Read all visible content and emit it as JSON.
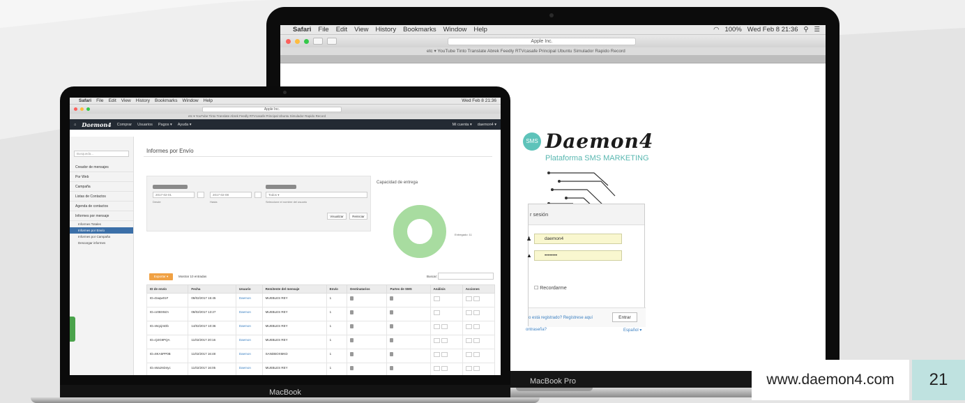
{
  "colors": {
    "accent_teal": "#5ec3ba",
    "export_orange": "#f0a144",
    "active_blue": "#3b6fa8",
    "nav_dark": "#232a33",
    "donut_green": "#a8dca0"
  },
  "menubar": {
    "app": "Safari",
    "items": [
      "File",
      "Edit",
      "View",
      "History",
      "Bookmarks",
      "Window",
      "Help"
    ],
    "battery": "100%",
    "datetime": "Wed Feb 8 21:36"
  },
  "front_menubar": {
    "datetime": "Wed Feb 8 21:36"
  },
  "browser": {
    "url": "Apple Inc.",
    "bookmarks": "etc ▾  YouTube  Tinto  Translate  Abrek  Feedly  RTVcasafe  Principal  Ubuntu  Simulador Rapido Record"
  },
  "login": {
    "sms_badge": "SMS",
    "brand": "Daemon4",
    "subtitle": "Plataforma SMS MARKETING",
    "panel_title": "r sesión",
    "username": "daemon4",
    "password": "••••••••",
    "remember": "Recordarme",
    "register": "o está registrado? Regístrese aquí",
    "enter_button": "Entrar",
    "forgot": "ontraseña?",
    "language": "Español ▾"
  },
  "app": {
    "brand": "Daemon4",
    "nav": [
      "Comprar",
      "Usuarios",
      "Pagos ▾",
      "Ayuda ▾"
    ],
    "nav_right": [
      "Mi cuenta ▾",
      "daemon4 ▾"
    ],
    "sidebar_search": "Busqueda...",
    "sidebar": [
      "Creador de mensajes",
      "Por Web",
      "Campaña",
      "Listas de Contactos",
      "Agenda de contactos",
      "Informes por mensaje"
    ],
    "sidebar_sub": [
      "Informes Totales",
      "Informes por Envío",
      "Informes por Campaña",
      "Descargar informes"
    ],
    "page_title": "Informes por Envío",
    "filter": {
      "date_from": "2017-02-01",
      "date_to": "2017-02-08",
      "cap_from": "Desde",
      "cap_to": "Hasta",
      "user": "Todos ▾",
      "user_caption": "Seleccione el nombre del usuario",
      "button_search": "Visualizar",
      "button_reset": "Reiniciar"
    },
    "capacity_title": "Capacidad de entrega",
    "legend": "Entregado: 11",
    "export_button": "Exportar ▾",
    "show": "Mostrar 10 entradas",
    "search_label": "Buscar:",
    "table": {
      "headers": [
        "ID de envío",
        "Fecha",
        "Usuario",
        "Remitente del mensaje",
        "Envío",
        "Destinatarios",
        "Partes de SMS",
        "Análisis",
        "Acciones"
      ],
      "rows": [
        {
          "id": "ID=Daqw01F",
          "date": "08/02/2017 15:45",
          "user": "Daemon",
          "sender": "MUEBLES REY",
          "envio": "1"
        },
        {
          "id": "ID=U0BX9ZA",
          "date": "08/02/2017 13:27",
          "user": "Daemon",
          "sender": "MUEBLES REY",
          "envio": "1"
        },
        {
          "id": "ID=Wq1jmDb",
          "date": "14/02/2017 10:36",
          "user": "Daemon",
          "sender": "MUEBLES REY",
          "envio": "1"
        },
        {
          "id": "ID=Q2G9PQA",
          "date": "11/02/2017 20:16",
          "user": "Daemon",
          "sender": "MUEBLES REY",
          "envio": "1"
        },
        {
          "id": "ID=8KA5PP0B",
          "date": "11/02/2017 16:48",
          "user": "Daemon",
          "sender": "SANDBOXMKD",
          "envio": "1"
        },
        {
          "id": "ID=Wa1ND4yc",
          "date": "11/02/2017 16:05",
          "user": "Daemon",
          "sender": "MUEBLES REY",
          "envio": "1"
        }
      ]
    }
  },
  "laptops": {
    "back": "MacBook Pro",
    "front": "MacBook"
  },
  "footer": {
    "website": "www.daemon4.com",
    "page": "21"
  }
}
